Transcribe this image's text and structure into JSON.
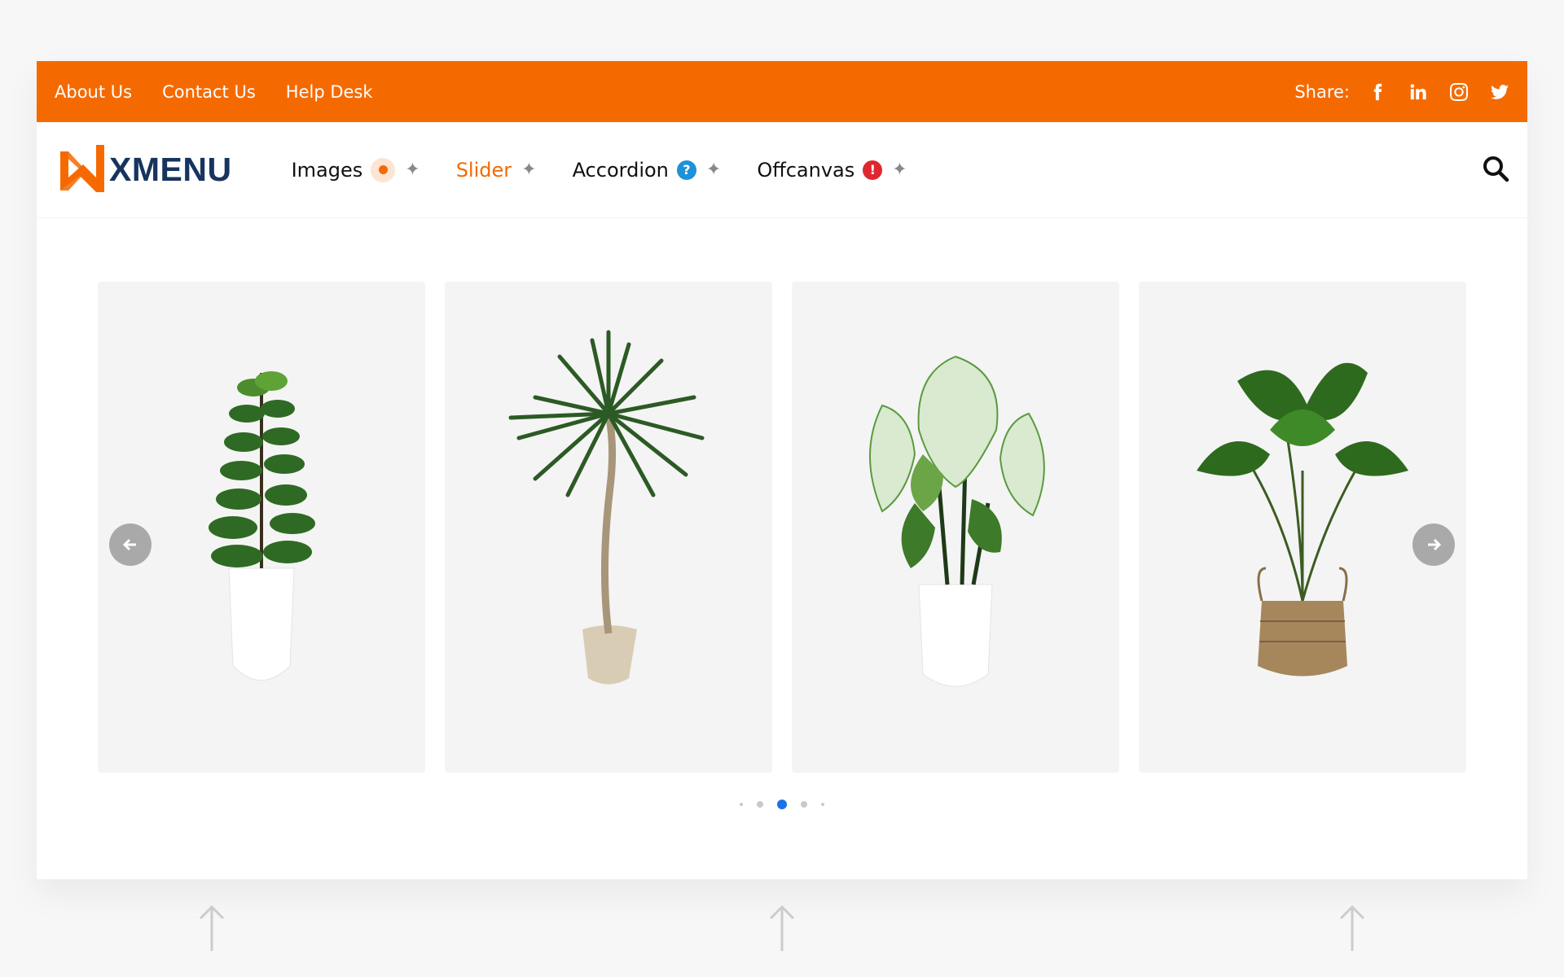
{
  "topbar": {
    "links": [
      "About Us",
      "Contact Us",
      "Help Desk"
    ],
    "share_label": "Share:",
    "socials": [
      "facebook-icon",
      "linkedin-icon",
      "instagram-icon",
      "twitter-icon"
    ],
    "bg_color": "#f56a00"
  },
  "logo": {
    "text": "XMENU",
    "text_color": "#17345f",
    "mark_color": "#f56a00"
  },
  "menu": {
    "items": [
      {
        "label": "Images",
        "badge": "dot"
      },
      {
        "label": "Slider",
        "badge": "",
        "active": true
      },
      {
        "label": "Accordion",
        "badge": "?"
      },
      {
        "label": "Offcanvas",
        "badge": "!"
      }
    ]
  },
  "slider": {
    "slides": [
      "fiddle-leaf-fig",
      "dracaena-palm",
      "caladium",
      "fan-palm-basket"
    ],
    "pagination_active": 3,
    "pagination_count": 5,
    "active_color": "#1a73e8"
  }
}
